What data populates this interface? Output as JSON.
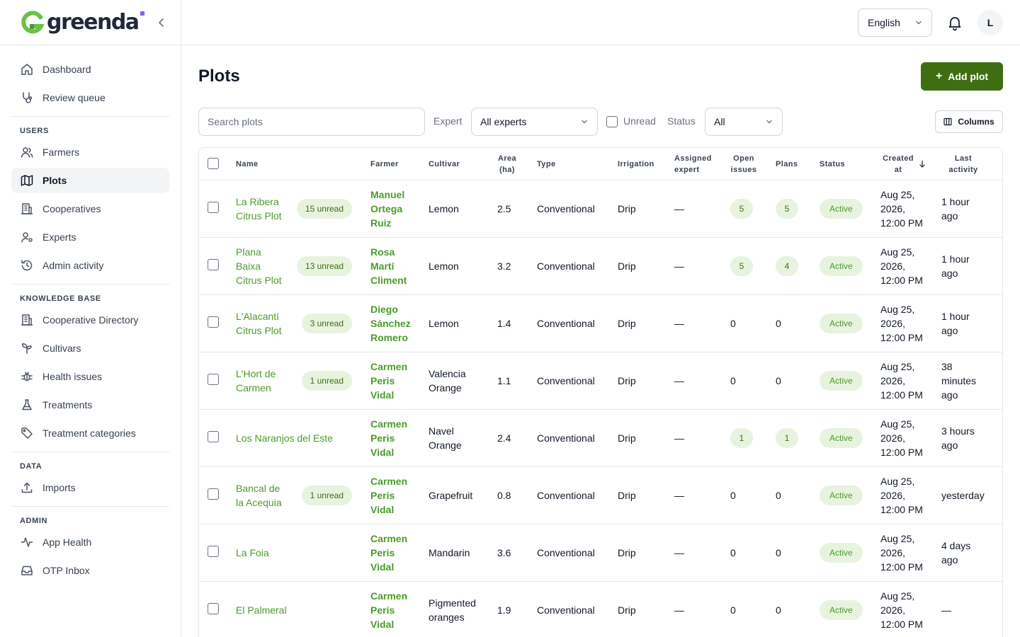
{
  "brand": {
    "name": "greenda",
    "accent": "#8b5cf6",
    "logo_color": "#6cc04a"
  },
  "sidebar": {
    "primary": [
      {
        "label": "Dashboard",
        "icon": "home-icon",
        "active": false
      },
      {
        "label": "Review queue",
        "icon": "stethoscope-icon",
        "active": false
      }
    ],
    "sections": [
      {
        "title": "USERS",
        "items": [
          {
            "label": "Farmers",
            "icon": "users-icon",
            "active": false
          },
          {
            "label": "Plots",
            "icon": "map-icon",
            "active": true
          },
          {
            "label": "Cooperatives",
            "icon": "building-icon",
            "active": false
          },
          {
            "label": "Experts",
            "icon": "user-cog-icon",
            "active": false
          },
          {
            "label": "Admin activity",
            "icon": "history-icon",
            "active": false
          }
        ]
      },
      {
        "title": "KNOWLEDGE BASE",
        "items": [
          {
            "label": "Cooperative Directory",
            "icon": "building-icon",
            "active": false
          },
          {
            "label": "Cultivars",
            "icon": "sprout-icon",
            "active": false
          },
          {
            "label": "Health issues",
            "icon": "bug-icon",
            "active": false
          },
          {
            "label": "Treatments",
            "icon": "flask-icon",
            "active": false
          },
          {
            "label": "Treatment categories",
            "icon": "tag-icon",
            "active": false
          }
        ]
      },
      {
        "title": "DATA",
        "items": [
          {
            "label": "Imports",
            "icon": "upload-icon",
            "active": false
          }
        ]
      },
      {
        "title": "ADMIN",
        "items": [
          {
            "label": "App Health",
            "icon": "activity-icon",
            "active": false
          },
          {
            "label": "OTP Inbox",
            "icon": "inbox-icon",
            "active": false
          }
        ]
      }
    ]
  },
  "topbar": {
    "language": "English",
    "avatar_initial": "L"
  },
  "page": {
    "title": "Plots",
    "add_label": "Add plot"
  },
  "filters": {
    "search_placeholder": "Search plots",
    "expert_label": "Expert",
    "expert_value": "All experts",
    "unread_label": "Unread",
    "status_label": "Status",
    "status_value": "All",
    "columns_label": "Columns"
  },
  "table": {
    "headers": {
      "name": "Name",
      "farmer": "Farmer",
      "cultivar": "Cultivar",
      "area": [
        "Area",
        "(ha)"
      ],
      "type": "Type",
      "irrigation": "Irrigation",
      "expert": [
        "Assigned",
        "expert"
      ],
      "issues": [
        "Open",
        "issues"
      ],
      "plans": "Plans",
      "status": "Status",
      "created": [
        "Created",
        "at"
      ],
      "activity": [
        "Last",
        "activity"
      ]
    },
    "rows": [
      {
        "name": [
          "La Ribera",
          "Citrus Plot"
        ],
        "unread": "15 unread",
        "farmer": [
          "Manuel",
          "Ortega",
          "Ruiz"
        ],
        "cultivar": [
          "Lemon"
        ],
        "area": "2.5",
        "type": "Conventional",
        "irrigation": "Drip",
        "expert": "—",
        "issues": "5",
        "issues_badge": true,
        "plans": "5",
        "plans_badge": true,
        "status": "Active",
        "created": [
          "Aug 25,",
          "2026,",
          "12:00 PM"
        ],
        "activity": [
          "1 hour",
          "ago"
        ]
      },
      {
        "name": [
          "Plana",
          "Baixa",
          "Citrus Plot"
        ],
        "unread": "13 unread",
        "farmer": [
          "Rosa",
          "Martí",
          "Climent"
        ],
        "cultivar": [
          "Lemon"
        ],
        "area": "3.2",
        "type": "Conventional",
        "irrigation": "Drip",
        "expert": "—",
        "issues": "5",
        "issues_badge": true,
        "plans": "4",
        "plans_badge": true,
        "status": "Active",
        "created": [
          "Aug 25,",
          "2026,",
          "12:00 PM"
        ],
        "activity": [
          "1 hour",
          "ago"
        ]
      },
      {
        "name": [
          "L'Alacantí",
          "Citrus Plot"
        ],
        "unread": "3 unread",
        "farmer": [
          "Diego",
          "Sánchez",
          "Romero"
        ],
        "cultivar": [
          "Lemon"
        ],
        "area": "1.4",
        "type": "Conventional",
        "irrigation": "Drip",
        "expert": "—",
        "issues": "0",
        "issues_badge": false,
        "plans": "0",
        "plans_badge": false,
        "status": "Active",
        "created": [
          "Aug 25,",
          "2026,",
          "12:00 PM"
        ],
        "activity": [
          "1 hour",
          "ago"
        ]
      },
      {
        "name": [
          "L'Hort de",
          "Carmen"
        ],
        "unread": "1 unread",
        "farmer": [
          "Carmen",
          "Peris",
          "Vidal"
        ],
        "cultivar": [
          "Valencia",
          "Orange"
        ],
        "area": "1.1",
        "type": "Conventional",
        "irrigation": "Drip",
        "expert": "—",
        "issues": "0",
        "issues_badge": false,
        "plans": "0",
        "plans_badge": false,
        "status": "Active",
        "created": [
          "Aug 25,",
          "2026,",
          "12:00 PM"
        ],
        "activity": [
          "38",
          "minutes",
          "ago"
        ]
      },
      {
        "name": [
          "Los Naranjos del Este"
        ],
        "unread": "",
        "farmer": [
          "Carmen",
          "Peris",
          "Vidal"
        ],
        "cultivar": [
          "Navel",
          "Orange"
        ],
        "area": "2.4",
        "type": "Conventional",
        "irrigation": "Drip",
        "expert": "—",
        "issues": "1",
        "issues_badge": true,
        "plans": "1",
        "plans_badge": true,
        "status": "Active",
        "created": [
          "Aug 25,",
          "2026,",
          "12:00 PM"
        ],
        "activity": [
          "3 hours",
          "ago"
        ]
      },
      {
        "name": [
          "Bancal de",
          "la Acequia"
        ],
        "unread": "1 unread",
        "farmer": [
          "Carmen",
          "Peris",
          "Vidal"
        ],
        "cultivar": [
          "Grapefruit"
        ],
        "area": "0.8",
        "type": "Conventional",
        "irrigation": "Drip",
        "expert": "—",
        "issues": "0",
        "issues_badge": false,
        "plans": "0",
        "plans_badge": false,
        "status": "Active",
        "created": [
          "Aug 25,",
          "2026,",
          "12:00 PM"
        ],
        "activity": [
          "yesterday"
        ]
      },
      {
        "name": [
          "La Foia"
        ],
        "unread": "",
        "farmer": [
          "Carmen",
          "Peris",
          "Vidal"
        ],
        "cultivar": [
          "Mandarin"
        ],
        "area": "3.6",
        "type": "Conventional",
        "irrigation": "Drip",
        "expert": "—",
        "issues": "0",
        "issues_badge": false,
        "plans": "0",
        "plans_badge": false,
        "status": "Active",
        "created": [
          "Aug 25,",
          "2026,",
          "12:00 PM"
        ],
        "activity": [
          "4 days",
          "ago"
        ]
      },
      {
        "name": [
          "El Palmeral"
        ],
        "unread": "",
        "farmer": [
          "Carmen",
          "Peris",
          "Vidal"
        ],
        "cultivar": [
          "Pigmented",
          "oranges"
        ],
        "area": "1.9",
        "type": "Conventional",
        "irrigation": "Drip",
        "expert": "—",
        "issues": "0",
        "issues_badge": false,
        "plans": "0",
        "plans_badge": false,
        "status": "Active",
        "created": [
          "Aug 25,",
          "2026,",
          "12:00 PM"
        ],
        "activity": [
          "—"
        ]
      }
    ]
  }
}
